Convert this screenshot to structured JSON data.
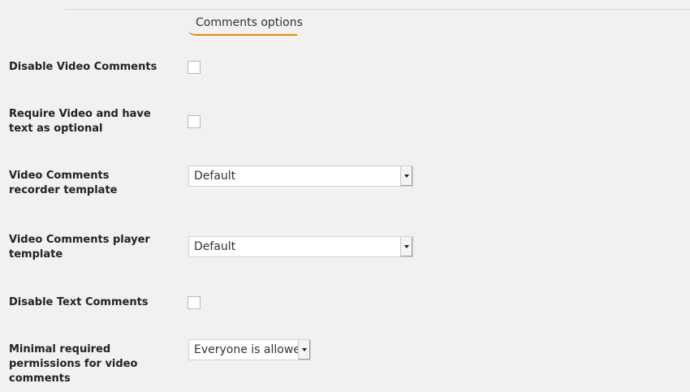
{
  "section": {
    "tab_label": "Comments options"
  },
  "rows": {
    "disable_video": {
      "label": "Disable Video Comments",
      "checked": false
    },
    "require_video": {
      "label": "Require Video and have text as optional",
      "checked": false
    },
    "recorder_template": {
      "label": "Video Comments recorder template",
      "value": "Default"
    },
    "player_template": {
      "label": "Video Comments player template",
      "value": "Default"
    },
    "disable_text": {
      "label": "Disable Text Comments",
      "checked": false
    },
    "permissions": {
      "label": "Minimal required permissions for video comments",
      "value": "Everyone is allowed"
    }
  },
  "icons": {
    "select_arrow": "chevron-down-icon"
  },
  "colors": {
    "accent": "#e08a0a",
    "background": "#f1f1f1"
  }
}
